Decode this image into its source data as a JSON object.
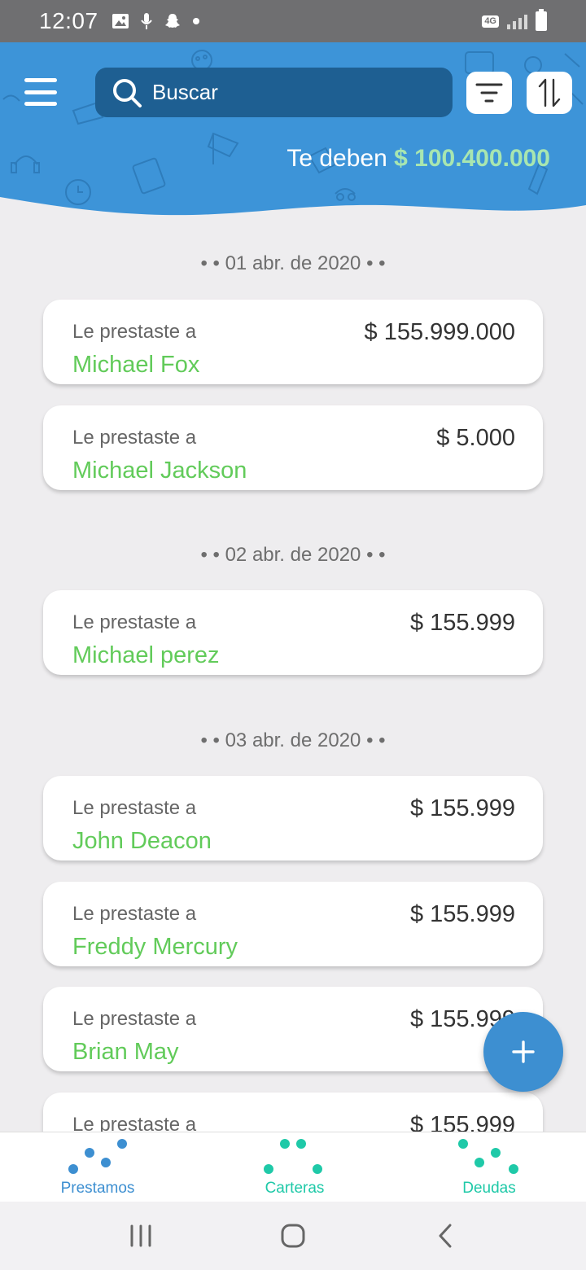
{
  "status_bar": {
    "time": "12:07",
    "network": "Voz 4G2"
  },
  "header": {
    "search_placeholder": "Buscar",
    "owed_label": "Te deben",
    "owed_amount": "$ 100.400.000"
  },
  "groups": [
    {
      "date": "• • 01 abr. de 2020 • •",
      "items": [
        {
          "label": "Le prestaste a",
          "name": "Michael Fox",
          "amount": "$ 155.999.000"
        },
        {
          "label": "Le prestaste a",
          "name": "Michael Jackson",
          "amount": "$ 5.000"
        }
      ]
    },
    {
      "date": "• • 02 abr. de 2020 • •",
      "items": [
        {
          "label": "Le prestaste a",
          "name": "Michael perez",
          "amount": "$ 155.999"
        }
      ]
    },
    {
      "date": "• • 03 abr. de 2020 • •",
      "items": [
        {
          "label": "Le prestaste a",
          "name": "John Deacon",
          "amount": "$ 155.999"
        },
        {
          "label": "Le prestaste a",
          "name": "Freddy Mercury",
          "amount": "$ 155.999"
        },
        {
          "label": "Le prestaste a",
          "name": "Brian May",
          "amount": "$ 155.999"
        },
        {
          "label": "Le prestaste a",
          "name": "",
          "amount": "$ 155.999"
        }
      ]
    }
  ],
  "bottom_nav": [
    {
      "label": "Prestamos",
      "color": "#3d8fd1"
    },
    {
      "label": "Carteras",
      "color": "#1fc9a8"
    },
    {
      "label": "Deudas",
      "color": "#1fc9a8"
    }
  ],
  "colors": {
    "header_blue": "#3d94d8",
    "search_bg": "#1e5f92",
    "name_green": "#62cb5a",
    "owed_green": "#a8e6b0",
    "fab_blue": "#3d8fd1"
  }
}
